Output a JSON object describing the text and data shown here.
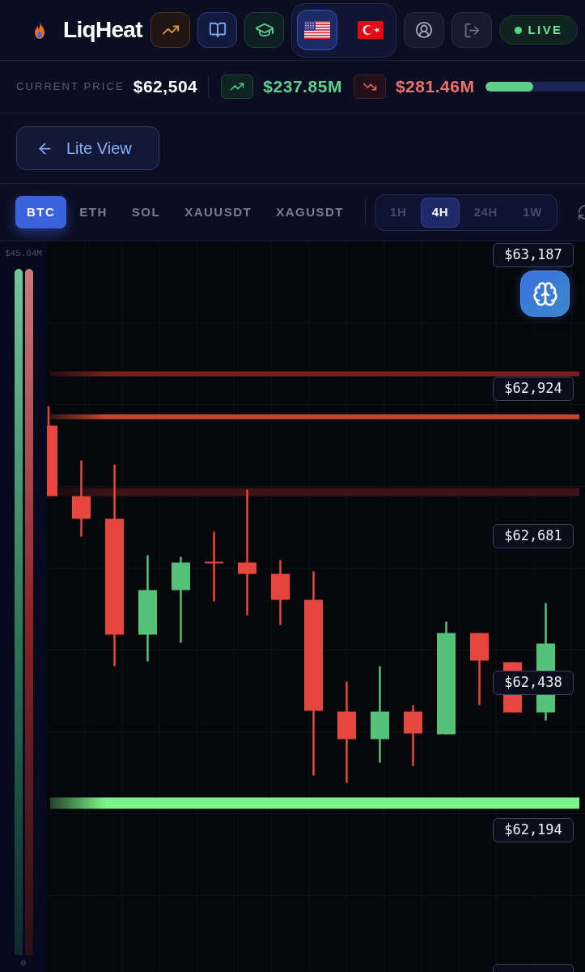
{
  "header": {
    "brand": "LiqHeat",
    "nav_buttons": [
      {
        "kind": "trends"
      },
      {
        "kind": "guide"
      },
      {
        "kind": "academy"
      }
    ],
    "languages": [
      {
        "kind": "us",
        "selected": true
      },
      {
        "kind": "tr",
        "selected": false
      }
    ],
    "account_buttons": [
      {
        "kind": "profile"
      },
      {
        "kind": "logout"
      }
    ],
    "status": {
      "label": "LIVE"
    }
  },
  "price_bar": {
    "label": "CURRENT PRICE",
    "price": "$62,504",
    "longs": "$237.85M",
    "shorts": "$281.46M",
    "balance": {
      "level": 0.46
    }
  },
  "view_toggle": {
    "label": "Lite View"
  },
  "symbols": [
    {
      "label": "BTC",
      "selected": true
    },
    {
      "label": "ETH",
      "selected": false
    },
    {
      "label": "SOL",
      "selected": false
    },
    {
      "label": "XAUUSDT",
      "selected": false
    },
    {
      "label": "XAGUSDT",
      "selected": false
    }
  ],
  "timeframes": [
    {
      "label": "1H",
      "selected": false
    },
    {
      "label": "4H",
      "selected": true
    },
    {
      "label": "24H",
      "selected": false
    },
    {
      "label": "1W",
      "selected": false
    }
  ],
  "heat_scale": {
    "max": "$45.04M",
    "min": "0"
  },
  "chart": {
    "price_labels": [
      "$63,187",
      "$62,924",
      "$62,681",
      "$62,438",
      "$62,194"
    ]
  }
}
